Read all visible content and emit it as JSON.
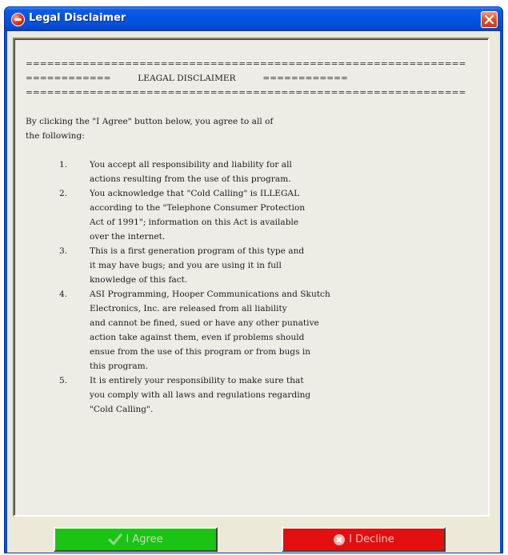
{
  "window": {
    "title": "Legal Disclaimer",
    "close_icon": "close-icon",
    "app_icon": "app-icon"
  },
  "disclaimer": {
    "rule_line": "==============================================================",
    "header_left": "============",
    "header_title": "LEAGAL DISCLAIMER",
    "header_right": "============",
    "intro_line1": "By clicking the \"I Agree\" button below, you agree to all of",
    "intro_line2": "the following:",
    "items": [
      {
        "num": "1.",
        "lines": [
          "You accept all responsibility and liability for all",
          "actions resulting from the use of this program."
        ]
      },
      {
        "num": "2.",
        "lines": [
          "You acknowledge that \"Cold Calling\" is ILLEGAL",
          "according to the \"Telephone Consumer Protection",
          "Act of 1991\"; information on this Act is available",
          "over the internet."
        ]
      },
      {
        "num": "3.",
        "lines": [
          "This is a first generation program of this type and",
          "it may have bugs; and you are using it in full",
          "knowledge of this fact."
        ]
      },
      {
        "num": "4.",
        "lines": [
          "ASI Programming, Hooper Communications and Skutch",
          "Electronics, Inc. are released from all liability",
          "and cannot be fined, sued or have any other punative",
          "action take against them, even if problems should",
          "ensue from the use of this program or from bugs in",
          "this program."
        ]
      },
      {
        "num": "5.",
        "lines": [
          "It is entirely your responsibility to make sure that",
          "you comply with all laws and regulations regarding",
          "\"Cold Calling\"."
        ]
      }
    ]
  },
  "buttons": {
    "agree_label": "I Agree",
    "agree_icon": "checkmark-icon",
    "agree_color": "#1bc414",
    "decline_label": "I Decline",
    "decline_icon": "decline-icon",
    "decline_color": "#e30f0f"
  }
}
